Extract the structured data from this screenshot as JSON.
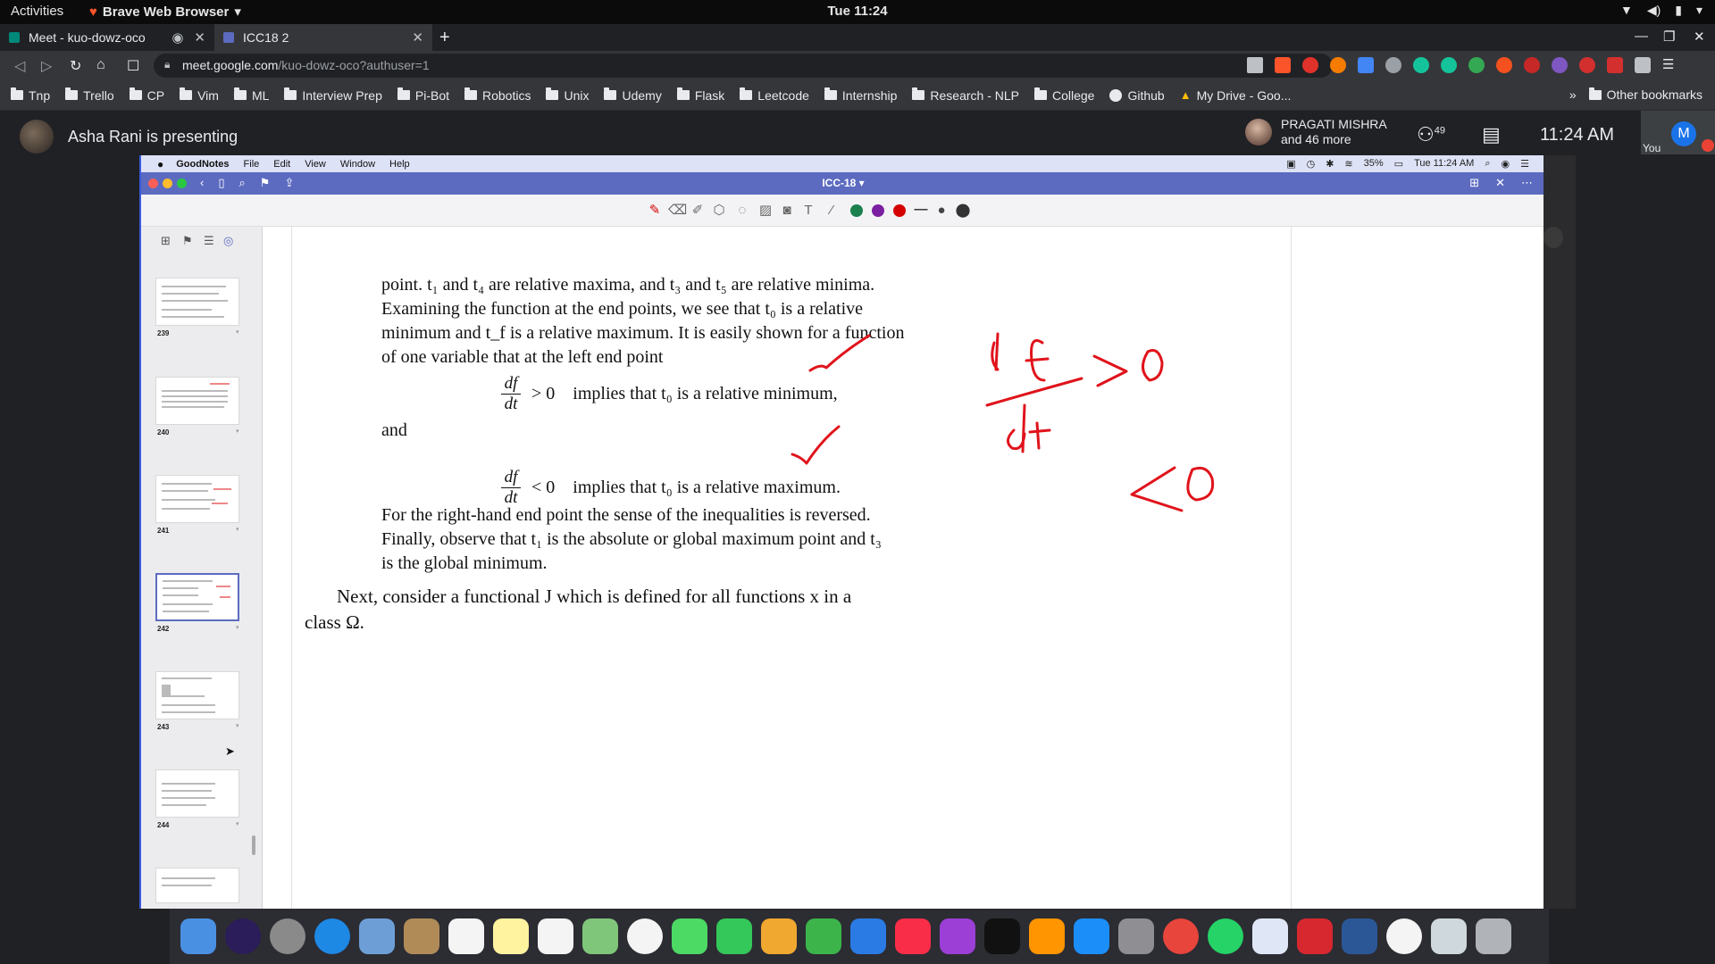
{
  "gnome": {
    "activities": "Activities",
    "app_name": "Brave Web Browser",
    "clock": "Tue 11:24"
  },
  "browser": {
    "tabs": [
      {
        "title": "Meet - kuo-dowz-oco",
        "fav_color": "#00897b"
      },
      {
        "title": "ICC18 2",
        "fav_color": "#5c6bc0"
      }
    ],
    "url_host": "meet.google.com",
    "url_path": "/kuo-dowz-oco?authuser=1",
    "bookmarks": [
      "Tnp",
      "Trello",
      "CP",
      "Vim",
      "ML",
      "Interview Prep",
      "Pi-Bot",
      "Robotics",
      "Unix",
      "Udemy",
      "Flask",
      "Leetcode",
      "Internship",
      "Research - NLP",
      "College",
      "Github",
      "My Drive - Goo..."
    ],
    "more_bookmarks": "»",
    "other_bookmarks": "Other bookmarks",
    "extension_badge": "12"
  },
  "meet": {
    "presenter_text": "Asha Rani is presenting",
    "participant_name": "PRAGATI MISHRA",
    "participant_more": "and 46 more",
    "people_count": "49",
    "time": "11:24 AM",
    "self_initial": "M",
    "self_label": "You"
  },
  "mac": {
    "menu": [
      "File",
      "Edit",
      "View",
      "Window",
      "Help"
    ],
    "app": "GoodNotes",
    "battery": "35%",
    "clock": "Tue 11:24 AM",
    "doc_title": "ICC-18 ▾",
    "pen_colors": [
      "#1b7f4e",
      "#7b1fa2",
      "#d50000"
    ]
  },
  "sidebar": {
    "pages": [
      {
        "num": "239"
      },
      {
        "num": "240"
      },
      {
        "num": "241"
      },
      {
        "num": "242",
        "selected": true
      },
      {
        "num": "243"
      },
      {
        "num": "244"
      }
    ]
  },
  "document": {
    "p1_line1": "point. t₁ and t₄ are relative maxima, and t₃ and t₅ are relative minima.",
    "p1_line2": "Examining the function at the end points, we see that t₀ is a relative",
    "p1_line3": "minimum and t_f is a relative maximum. It is easily shown for a function",
    "p1_line4": "of one variable that at the left end point",
    "eq1_num": "df",
    "eq1_den": "dt",
    "eq1_rel": "> 0",
    "eq1_text": "implies that t₀ is a relative minimum,",
    "and": "and",
    "eq2_num": "df",
    "eq2_den": "dt",
    "eq2_rel": "< 0",
    "eq2_text": "implies that t₀ is a relative maximum.",
    "p2_line1": "For the right-hand end point the sense of the inequalities is reversed.",
    "p2_line2": "Finally, observe that t₁ is the absolute or global maximum point and t₃",
    "p2_line3": "is the global minimum.",
    "p3_line1": "Next, consider a functional J which is defined for all functions x in a",
    "p3_line2": "class Ω."
  },
  "ink_color": "#e0131b"
}
